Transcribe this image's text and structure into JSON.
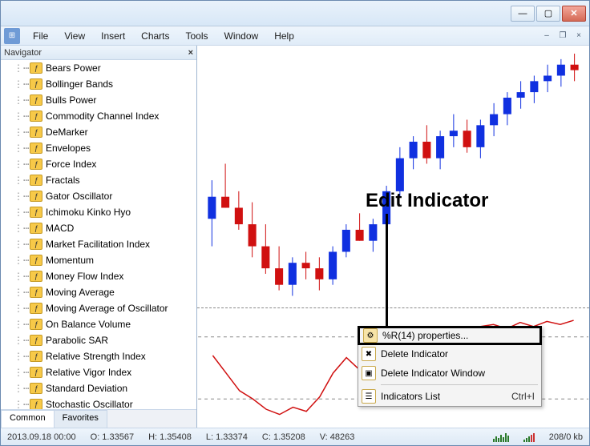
{
  "titlebar": {
    "minimize": "—",
    "maximize": "▢",
    "close": "✕"
  },
  "menubar": {
    "app_icon": "⊞",
    "items": [
      "File",
      "View",
      "Insert",
      "Charts",
      "Tools",
      "Window",
      "Help"
    ]
  },
  "mdi": {
    "min": "–",
    "restore": "❐",
    "close": "×"
  },
  "navigator": {
    "title": "Navigator",
    "close": "×",
    "items": [
      "Bears Power",
      "Bollinger Bands",
      "Bulls Power",
      "Commodity Channel Index",
      "DeMarker",
      "Envelopes",
      "Force Index",
      "Fractals",
      "Gator Oscillator",
      "Ichimoku Kinko Hyo",
      "MACD",
      "Market Facilitation Index",
      "Momentum",
      "Money Flow Index",
      "Moving Average",
      "Moving Average of Oscillator",
      "On Balance Volume",
      "Parabolic SAR",
      "Relative Strength Index",
      "Relative Vigor Index",
      "Standard Deviation",
      "Stochastic Oscillator",
      "Volumes"
    ],
    "tabs": {
      "common": "Common",
      "favorites": "Favorites"
    }
  },
  "annotation": {
    "label": "Edit Indicator"
  },
  "context_menu": {
    "properties": "%R(14) properties...",
    "delete_indicator": "Delete Indicator",
    "delete_window": "Delete Indicator Window",
    "indicators_list": "Indicators List",
    "shortcut": "Ctrl+I"
  },
  "statusbar": {
    "datetime": "2013.09.18 00:00",
    "open": "O: 1.33567",
    "high": "H: 1.35408",
    "low": "L: 1.33374",
    "close": "C: 1.35208",
    "volume": "V: 48263",
    "net": "208/0 kb"
  },
  "chart_data": {
    "type": "candlestick",
    "title": "",
    "xlabel": "",
    "ylabel": "",
    "ylim": [
      1.32,
      1.365
    ],
    "candles": [
      {
        "o": 1.335,
        "h": 1.342,
        "l": 1.33,
        "c": 1.339
      },
      {
        "o": 1.339,
        "h": 1.345,
        "l": 1.337,
        "c": 1.337
      },
      {
        "o": 1.337,
        "h": 1.34,
        "l": 1.333,
        "c": 1.334
      },
      {
        "o": 1.334,
        "h": 1.338,
        "l": 1.328,
        "c": 1.33
      },
      {
        "o": 1.33,
        "h": 1.334,
        "l": 1.325,
        "c": 1.326
      },
      {
        "o": 1.326,
        "h": 1.33,
        "l": 1.322,
        "c": 1.323
      },
      {
        "o": 1.323,
        "h": 1.328,
        "l": 1.321,
        "c": 1.327
      },
      {
        "o": 1.327,
        "h": 1.329,
        "l": 1.324,
        "c": 1.326
      },
      {
        "o": 1.326,
        "h": 1.328,
        "l": 1.322,
        "c": 1.324
      },
      {
        "o": 1.324,
        "h": 1.33,
        "l": 1.323,
        "c": 1.329
      },
      {
        "o": 1.329,
        "h": 1.334,
        "l": 1.328,
        "c": 1.333
      },
      {
        "o": 1.333,
        "h": 1.336,
        "l": 1.331,
        "c": 1.331
      },
      {
        "o": 1.331,
        "h": 1.335,
        "l": 1.329,
        "c": 1.334
      },
      {
        "o": 1.334,
        "h": 1.341,
        "l": 1.333,
        "c": 1.34
      },
      {
        "o": 1.34,
        "h": 1.348,
        "l": 1.339,
        "c": 1.346
      },
      {
        "o": 1.346,
        "h": 1.35,
        "l": 1.344,
        "c": 1.349
      },
      {
        "o": 1.349,
        "h": 1.352,
        "l": 1.345,
        "c": 1.346
      },
      {
        "o": 1.346,
        "h": 1.351,
        "l": 1.344,
        "c": 1.35
      },
      {
        "o": 1.35,
        "h": 1.354,
        "l": 1.348,
        "c": 1.351
      },
      {
        "o": 1.351,
        "h": 1.353,
        "l": 1.347,
        "c": 1.348
      },
      {
        "o": 1.348,
        "h": 1.353,
        "l": 1.346,
        "c": 1.352
      },
      {
        "o": 1.352,
        "h": 1.356,
        "l": 1.35,
        "c": 1.354
      },
      {
        "o": 1.354,
        "h": 1.358,
        "l": 1.352,
        "c": 1.357
      },
      {
        "o": 1.357,
        "h": 1.36,
        "l": 1.355,
        "c": 1.358
      },
      {
        "o": 1.358,
        "h": 1.361,
        "l": 1.356,
        "c": 1.36
      },
      {
        "o": 1.36,
        "h": 1.363,
        "l": 1.358,
        "c": 1.361
      },
      {
        "o": 1.361,
        "h": 1.364,
        "l": 1.359,
        "c": 1.363
      },
      {
        "o": 1.363,
        "h": 1.365,
        "l": 1.36,
        "c": 1.362
      }
    ],
    "indicator": {
      "type": "line",
      "name": "%R(14)",
      "ylim": [
        -100,
        0
      ],
      "values": [
        -38,
        -55,
        -72,
        -80,
        -90,
        -95,
        -88,
        -92,
        -78,
        -55,
        -40,
        -52,
        -35,
        -18,
        -10,
        -22,
        -12,
        -18,
        -25,
        -15,
        -10,
        -8,
        -12,
        -6,
        -10,
        -5,
        -8,
        -4
      ]
    }
  }
}
